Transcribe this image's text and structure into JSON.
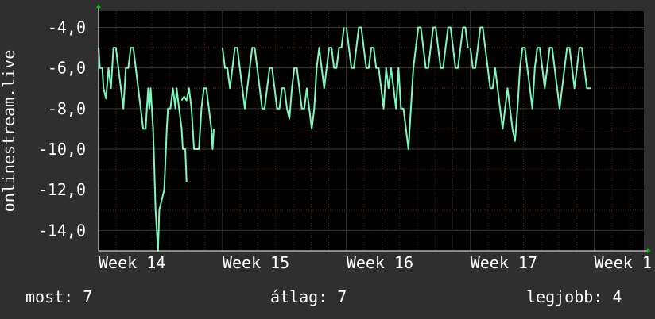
{
  "chart_data": {
    "type": "line",
    "ylabel": "onlinestream.live",
    "yticks": [
      "-4,0",
      "-6,0",
      "-8,0",
      "-10,0",
      "-12,0",
      "-14,0"
    ],
    "ytick_values": [
      -4,
      -6,
      -8,
      -10,
      -12,
      -14
    ],
    "ylim": [
      -15,
      -3.2
    ],
    "xlim": [
      0,
      4.4
    ],
    "xticks": [
      "Week 14",
      "Week 15",
      "Week 16",
      "Week 17",
      "Week 1"
    ],
    "xtick_values": [
      0,
      1,
      2,
      3,
      4
    ],
    "grid": true,
    "colors": {
      "background": "#2f2f2f",
      "plot": "#000000",
      "line": "#7ff7bf",
      "grid": "#3a3a3a",
      "minor_grid": "#5a1a1a",
      "axis_arrow": "#00c000"
    },
    "series": [
      {
        "segments": [
          [
            [
              0,
              -5
            ],
            [
              0.01,
              -6
            ],
            [
              0.03,
              -6
            ],
            [
              0.04,
              -7
            ],
            [
              0.06,
              -7.5
            ],
            [
              0.08,
              -6
            ],
            [
              0.1,
              -7
            ],
            [
              0.12,
              -5
            ],
            [
              0.14,
              -5
            ],
            [
              0.16,
              -6
            ],
            [
              0.18,
              -7
            ],
            [
              0.2,
              -8
            ],
            [
              0.22,
              -6
            ],
            [
              0.24,
              -6
            ],
            [
              0.26,
              -5
            ],
            [
              0.28,
              -5
            ],
            [
              0.3,
              -6
            ],
            [
              0.32,
              -7
            ],
            [
              0.34,
              -8
            ],
            [
              0.36,
              -9
            ],
            [
              0.38,
              -9
            ],
            [
              0.39,
              -8
            ],
            [
              0.4,
              -7
            ],
            [
              0.41,
              -8
            ],
            [
              0.42,
              -7
            ],
            [
              0.44,
              -9
            ],
            [
              0.45,
              -11
            ],
            [
              0.46,
              -13
            ],
            [
              0.48,
              -15
            ],
            [
              0.49,
              -13
            ],
            [
              0.51,
              -12.5
            ],
            [
              0.53,
              -12
            ],
            [
              0.55,
              -9
            ],
            [
              0.56,
              -8
            ],
            [
              0.58,
              -8
            ],
            [
              0.6,
              -7
            ],
            [
              0.62,
              -8
            ],
            [
              0.63,
              -7
            ],
            [
              0.65,
              -8
            ],
            [
              0.67,
              -9
            ],
            [
              0.68,
              -10
            ],
            [
              0.7,
              -10
            ],
            [
              0.71,
              -11.6
            ]
          ],
          [
            [
              0.67,
              -7.6
            ],
            [
              0.69,
              -7.4
            ],
            [
              0.71,
              -7.6
            ],
            [
              0.73,
              -7
            ],
            [
              0.75,
              -8
            ],
            [
              0.77,
              -10
            ],
            [
              0.79,
              -10
            ],
            [
              0.81,
              -10
            ],
            [
              0.83,
              -8
            ],
            [
              0.85,
              -7
            ],
            [
              0.87,
              -7
            ],
            [
              0.89,
              -8
            ],
            [
              0.91,
              -9
            ],
            [
              0.92,
              -10
            ],
            [
              0.93,
              -9
            ]
          ],
          [
            [
              1,
              -5
            ],
            [
              1.02,
              -6
            ],
            [
              1.04,
              -6
            ],
            [
              1.06,
              -7
            ],
            [
              1.08,
              -6
            ],
            [
              1.1,
              -5
            ],
            [
              1.12,
              -5
            ],
            [
              1.14,
              -6
            ],
            [
              1.16,
              -7
            ],
            [
              1.18,
              -8
            ],
            [
              1.2,
              -7
            ],
            [
              1.22,
              -6
            ],
            [
              1.24,
              -5
            ],
            [
              1.26,
              -5
            ],
            [
              1.28,
              -6
            ],
            [
              1.3,
              -7
            ],
            [
              1.32,
              -8
            ],
            [
              1.34,
              -8
            ],
            [
              1.36,
              -7
            ],
            [
              1.38,
              -6
            ],
            [
              1.4,
              -6
            ],
            [
              1.42,
              -7
            ],
            [
              1.44,
              -8
            ],
            [
              1.46,
              -8
            ],
            [
              1.48,
              -7
            ],
            [
              1.5,
              -7
            ],
            [
              1.52,
              -8
            ],
            [
              1.54,
              -8.5
            ],
            [
              1.56,
              -7
            ],
            [
              1.58,
              -6
            ],
            [
              1.6,
              -6
            ],
            [
              1.62,
              -7
            ],
            [
              1.64,
              -8
            ],
            [
              1.66,
              -8
            ],
            [
              1.68,
              -7
            ],
            [
              1.7,
              -8
            ],
            [
              1.72,
              -9
            ],
            [
              1.74,
              -8
            ],
            [
              1.76,
              -6
            ],
            [
              1.78,
              -5
            ],
            [
              1.8,
              -6
            ],
            [
              1.82,
              -7
            ],
            [
              1.84,
              -6
            ],
            [
              1.86,
              -5
            ],
            [
              1.88,
              -5
            ],
            [
              1.9,
              -6
            ],
            [
              1.92,
              -6
            ],
            [
              1.94,
              -5
            ],
            [
              1.96,
              -5
            ],
            [
              1.98,
              -4
            ]
          ],
          [
            [
              2,
              -4
            ],
            [
              2.02,
              -5
            ],
            [
              2.04,
              -6
            ],
            [
              2.06,
              -6
            ],
            [
              2.08,
              -5
            ],
            [
              2.1,
              -4
            ],
            [
              2.12,
              -4
            ],
            [
              2.14,
              -5
            ],
            [
              2.16,
              -6
            ],
            [
              2.18,
              -6
            ],
            [
              2.2,
              -5
            ],
            [
              2.22,
              -5
            ],
            [
              2.24,
              -6
            ],
            [
              2.26,
              -6
            ],
            [
              2.28,
              -7
            ],
            [
              2.3,
              -8
            ],
            [
              2.32,
              -6
            ],
            [
              2.34,
              -7
            ],
            [
              2.36,
              -6
            ],
            [
              2.38,
              -7
            ],
            [
              2.4,
              -8
            ],
            [
              2.42,
              -6
            ],
            [
              2.44,
              -8
            ],
            [
              2.46,
              -8
            ],
            [
              2.48,
              -9
            ],
            [
              2.5,
              -10
            ],
            [
              2.52,
              -8
            ],
            [
              2.54,
              -6
            ],
            [
              2.56,
              -5
            ],
            [
              2.58,
              -4
            ],
            [
              2.6,
              -4
            ],
            [
              2.62,
              -5
            ],
            [
              2.64,
              -6
            ],
            [
              2.66,
              -6
            ],
            [
              2.68,
              -5
            ],
            [
              2.7,
              -4
            ],
            [
              2.72,
              -4
            ],
            [
              2.74,
              -5
            ],
            [
              2.76,
              -6
            ],
            [
              2.78,
              -6
            ],
            [
              2.8,
              -5
            ],
            [
              2.82,
              -4
            ],
            [
              2.84,
              -4
            ],
            [
              2.86,
              -5
            ],
            [
              2.88,
              -6
            ],
            [
              2.9,
              -6
            ],
            [
              2.92,
              -5
            ],
            [
              2.94,
              -4
            ],
            [
              2.96,
              -4
            ],
            [
              2.98,
              -5
            ]
          ],
          [
            [
              3,
              -5
            ],
            [
              3.02,
              -6
            ],
            [
              3.04,
              -6
            ],
            [
              3.06,
              -5
            ],
            [
              3.08,
              -4
            ],
            [
              3.1,
              -4
            ],
            [
              3.12,
              -5
            ],
            [
              3.14,
              -6
            ],
            [
              3.16,
              -7
            ],
            [
              3.18,
              -7
            ],
            [
              3.2,
              -6
            ],
            [
              3.22,
              -7
            ],
            [
              3.24,
              -8
            ],
            [
              3.26,
              -9
            ],
            [
              3.28,
              -8
            ],
            [
              3.3,
              -7
            ],
            [
              3.32,
              -8
            ],
            [
              3.34,
              -9
            ],
            [
              3.36,
              -9.6
            ],
            [
              3.38,
              -8
            ],
            [
              3.4,
              -6
            ],
            [
              3.42,
              -5
            ],
            [
              3.44,
              -5
            ],
            [
              3.46,
              -6
            ],
            [
              3.48,
              -7
            ],
            [
              3.5,
              -8
            ],
            [
              3.52,
              -6
            ],
            [
              3.54,
              -5
            ],
            [
              3.56,
              -5
            ],
            [
              3.58,
              -6
            ],
            [
              3.6,
              -7
            ],
            [
              3.62,
              -6
            ],
            [
              3.64,
              -5
            ],
            [
              3.66,
              -5
            ],
            [
              3.68,
              -6
            ],
            [
              3.7,
              -7
            ],
            [
              3.72,
              -8
            ],
            [
              3.74,
              -7
            ],
            [
              3.76,
              -6
            ],
            [
              3.78,
              -5
            ],
            [
              3.8,
              -5
            ],
            [
              3.82,
              -6
            ],
            [
              3.84,
              -7
            ],
            [
              3.86,
              -6
            ],
            [
              3.88,
              -5
            ],
            [
              3.9,
              -5
            ],
            [
              3.92,
              -6
            ],
            [
              3.94,
              -7
            ],
            [
              3.96,
              -7
            ],
            [
              3.97,
              -7
            ]
          ]
        ]
      }
    ]
  },
  "footer": {
    "now": "most: 7",
    "avg": "átlag: 7",
    "best": "legjobb: 4"
  }
}
